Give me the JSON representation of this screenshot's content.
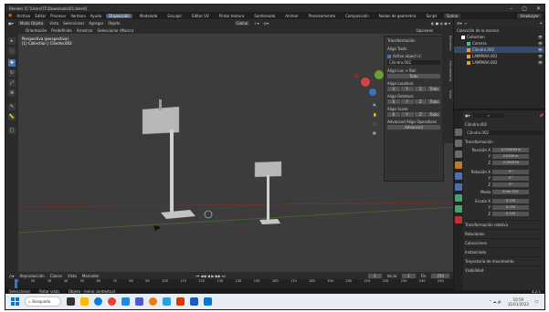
{
  "window": {
    "title": "Blender [C:\\Users\\TC\\Downloads\\01.blend]",
    "controls": [
      "–",
      "▢",
      "✕"
    ]
  },
  "menu": {
    "items": [
      "Archivo",
      "Editar",
      "Procesar",
      "Ventana",
      "Ayuda"
    ],
    "workspaces": [
      "Disposición",
      "Modelado",
      "Esculpir",
      "Editar UV",
      "Pintar textura",
      "Sombreado",
      "Animar",
      "Procesamiento",
      "Composición",
      "Nodos de geometría",
      "Script"
    ],
    "active_workspace": "Disposición",
    "scene": "Scene",
    "view_layer": "ViewLayer"
  },
  "viewport": {
    "mode": "Modo Objeto",
    "header_items": [
      "Vista",
      "Seleccionar",
      "Agregar",
      "Objeto"
    ],
    "orientation": "Global",
    "header2_items": [
      "Orientación",
      "Predefinido",
      "Arrastrar",
      "Seleccionar (Marco)"
    ],
    "info_line1": "Perspectiva (perspectiva)",
    "info_line2": "(1) Collection | Cilindro.002",
    "options": "Opciones"
  },
  "npanel": {
    "transform": "Transformación",
    "align_tools": "Align Tools",
    "active_object": "Active object is:",
    "object_name": "Cilindro.002",
    "align_loc_rot": "Align Loc + Rot:",
    "all": "Todo",
    "align_location": "Align Location:",
    "align_rotation": "Align Rotation:",
    "align_scale": "Align Scale:",
    "axes": [
      "X",
      "Y",
      "Z"
    ],
    "advanced_ops": "Advanced Align Operations",
    "advanced": "Advanced",
    "side_tabs": [
      "Elemento",
      "Herramienta",
      "Vista"
    ]
  },
  "timeline": {
    "items": [
      "Reproducción",
      "Claves",
      "Vista",
      "Marcador"
    ],
    "frame": "1",
    "start_label": "Inicio",
    "start": "1",
    "end_label": "Fin",
    "end": "250",
    "ticks": [
      "10",
      "20",
      "30",
      "40",
      "50",
      "60",
      "70",
      "80",
      "90",
      "100",
      "110",
      "120",
      "130",
      "140",
      "150",
      "160",
      "170",
      "180",
      "190",
      "200",
      "210",
      "220",
      "230",
      "240",
      "250"
    ]
  },
  "status": {
    "items": [
      "Seleccionar",
      "Rotar vista",
      "Objeto - menú contextual"
    ],
    "version": "3.2.1"
  },
  "outliner": {
    "title": "Colección de la escena",
    "items": [
      {
        "name": "Collection",
        "color": "#ffffff"
      },
      {
        "name": "Camera",
        "color": "#4bc27a"
      },
      {
        "name": "Cilindro.002",
        "color": "#e0a040"
      },
      {
        "name": "LAMPARA.001",
        "color": "#e0a040"
      },
      {
        "name": "LAMPARA.002",
        "color": "#e0a040"
      }
    ]
  },
  "properties": {
    "object_name": "Cilindro.002",
    "object_field": "Cilindro.002",
    "transform": "Transformación",
    "location": {
      "label": "Posición X",
      "x": "-0.594046 m",
      "y": "0.0138 m",
      "z": "-0.094296"
    },
    "rotation": {
      "label": "Rotación X",
      "x": "0°",
      "y": "0°",
      "z": "0°"
    },
    "mode": {
      "label": "Modo",
      "value": "Euler XYZ"
    },
    "scale": {
      "label": "Escala X",
      "x": "0.150",
      "y": "0.150",
      "z": "0.150"
    },
    "sections": [
      "Transformación relativa",
      "Relaciones",
      "Colecciones",
      "Instanciado",
      "Trayectoria de movimiento",
      "Visibilidad"
    ]
  },
  "taskbar": {
    "search": "Búsqueda",
    "time": "10:59",
    "date": "31/01/2022"
  }
}
